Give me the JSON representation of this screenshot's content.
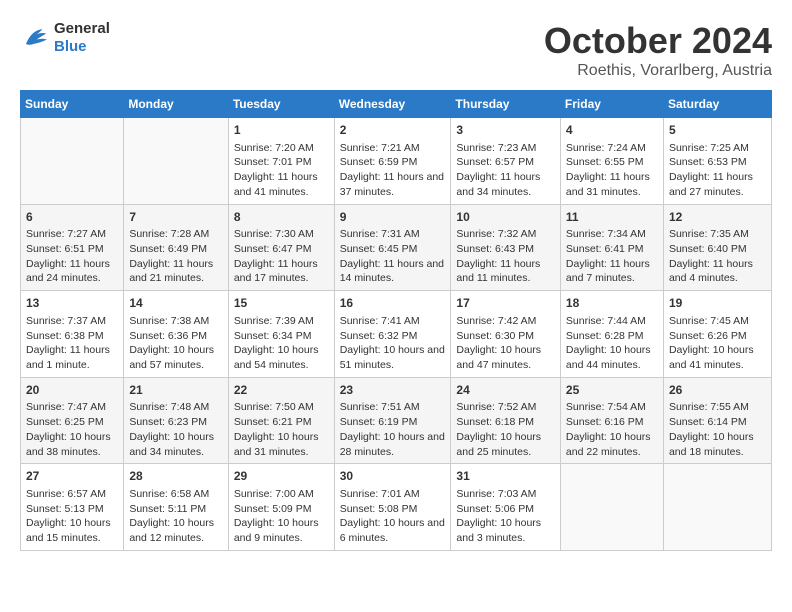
{
  "header": {
    "logo_line1": "General",
    "logo_line2": "Blue",
    "month": "October 2024",
    "location": "Roethis, Vorarlberg, Austria"
  },
  "columns": [
    "Sunday",
    "Monday",
    "Tuesday",
    "Wednesday",
    "Thursday",
    "Friday",
    "Saturday"
  ],
  "weeks": [
    [
      {
        "day": "",
        "info": ""
      },
      {
        "day": "",
        "info": ""
      },
      {
        "day": "1",
        "info": "Sunrise: 7:20 AM\nSunset: 7:01 PM\nDaylight: 11 hours and 41 minutes."
      },
      {
        "day": "2",
        "info": "Sunrise: 7:21 AM\nSunset: 6:59 PM\nDaylight: 11 hours and 37 minutes."
      },
      {
        "day": "3",
        "info": "Sunrise: 7:23 AM\nSunset: 6:57 PM\nDaylight: 11 hours and 34 minutes."
      },
      {
        "day": "4",
        "info": "Sunrise: 7:24 AM\nSunset: 6:55 PM\nDaylight: 11 hours and 31 minutes."
      },
      {
        "day": "5",
        "info": "Sunrise: 7:25 AM\nSunset: 6:53 PM\nDaylight: 11 hours and 27 minutes."
      }
    ],
    [
      {
        "day": "6",
        "info": "Sunrise: 7:27 AM\nSunset: 6:51 PM\nDaylight: 11 hours and 24 minutes."
      },
      {
        "day": "7",
        "info": "Sunrise: 7:28 AM\nSunset: 6:49 PM\nDaylight: 11 hours and 21 minutes."
      },
      {
        "day": "8",
        "info": "Sunrise: 7:30 AM\nSunset: 6:47 PM\nDaylight: 11 hours and 17 minutes."
      },
      {
        "day": "9",
        "info": "Sunrise: 7:31 AM\nSunset: 6:45 PM\nDaylight: 11 hours and 14 minutes."
      },
      {
        "day": "10",
        "info": "Sunrise: 7:32 AM\nSunset: 6:43 PM\nDaylight: 11 hours and 11 minutes."
      },
      {
        "day": "11",
        "info": "Sunrise: 7:34 AM\nSunset: 6:41 PM\nDaylight: 11 hours and 7 minutes."
      },
      {
        "day": "12",
        "info": "Sunrise: 7:35 AM\nSunset: 6:40 PM\nDaylight: 11 hours and 4 minutes."
      }
    ],
    [
      {
        "day": "13",
        "info": "Sunrise: 7:37 AM\nSunset: 6:38 PM\nDaylight: 11 hours and 1 minute."
      },
      {
        "day": "14",
        "info": "Sunrise: 7:38 AM\nSunset: 6:36 PM\nDaylight: 10 hours and 57 minutes."
      },
      {
        "day": "15",
        "info": "Sunrise: 7:39 AM\nSunset: 6:34 PM\nDaylight: 10 hours and 54 minutes."
      },
      {
        "day": "16",
        "info": "Sunrise: 7:41 AM\nSunset: 6:32 PM\nDaylight: 10 hours and 51 minutes."
      },
      {
        "day": "17",
        "info": "Sunrise: 7:42 AM\nSunset: 6:30 PM\nDaylight: 10 hours and 47 minutes."
      },
      {
        "day": "18",
        "info": "Sunrise: 7:44 AM\nSunset: 6:28 PM\nDaylight: 10 hours and 44 minutes."
      },
      {
        "day": "19",
        "info": "Sunrise: 7:45 AM\nSunset: 6:26 PM\nDaylight: 10 hours and 41 minutes."
      }
    ],
    [
      {
        "day": "20",
        "info": "Sunrise: 7:47 AM\nSunset: 6:25 PM\nDaylight: 10 hours and 38 minutes."
      },
      {
        "day": "21",
        "info": "Sunrise: 7:48 AM\nSunset: 6:23 PM\nDaylight: 10 hours and 34 minutes."
      },
      {
        "day": "22",
        "info": "Sunrise: 7:50 AM\nSunset: 6:21 PM\nDaylight: 10 hours and 31 minutes."
      },
      {
        "day": "23",
        "info": "Sunrise: 7:51 AM\nSunset: 6:19 PM\nDaylight: 10 hours and 28 minutes."
      },
      {
        "day": "24",
        "info": "Sunrise: 7:52 AM\nSunset: 6:18 PM\nDaylight: 10 hours and 25 minutes."
      },
      {
        "day": "25",
        "info": "Sunrise: 7:54 AM\nSunset: 6:16 PM\nDaylight: 10 hours and 22 minutes."
      },
      {
        "day": "26",
        "info": "Sunrise: 7:55 AM\nSunset: 6:14 PM\nDaylight: 10 hours and 18 minutes."
      }
    ],
    [
      {
        "day": "27",
        "info": "Sunrise: 6:57 AM\nSunset: 5:13 PM\nDaylight: 10 hours and 15 minutes."
      },
      {
        "day": "28",
        "info": "Sunrise: 6:58 AM\nSunset: 5:11 PM\nDaylight: 10 hours and 12 minutes."
      },
      {
        "day": "29",
        "info": "Sunrise: 7:00 AM\nSunset: 5:09 PM\nDaylight: 10 hours and 9 minutes."
      },
      {
        "day": "30",
        "info": "Sunrise: 7:01 AM\nSunset: 5:08 PM\nDaylight: 10 hours and 6 minutes."
      },
      {
        "day": "31",
        "info": "Sunrise: 7:03 AM\nSunset: 5:06 PM\nDaylight: 10 hours and 3 minutes."
      },
      {
        "day": "",
        "info": ""
      },
      {
        "day": "",
        "info": ""
      }
    ]
  ]
}
